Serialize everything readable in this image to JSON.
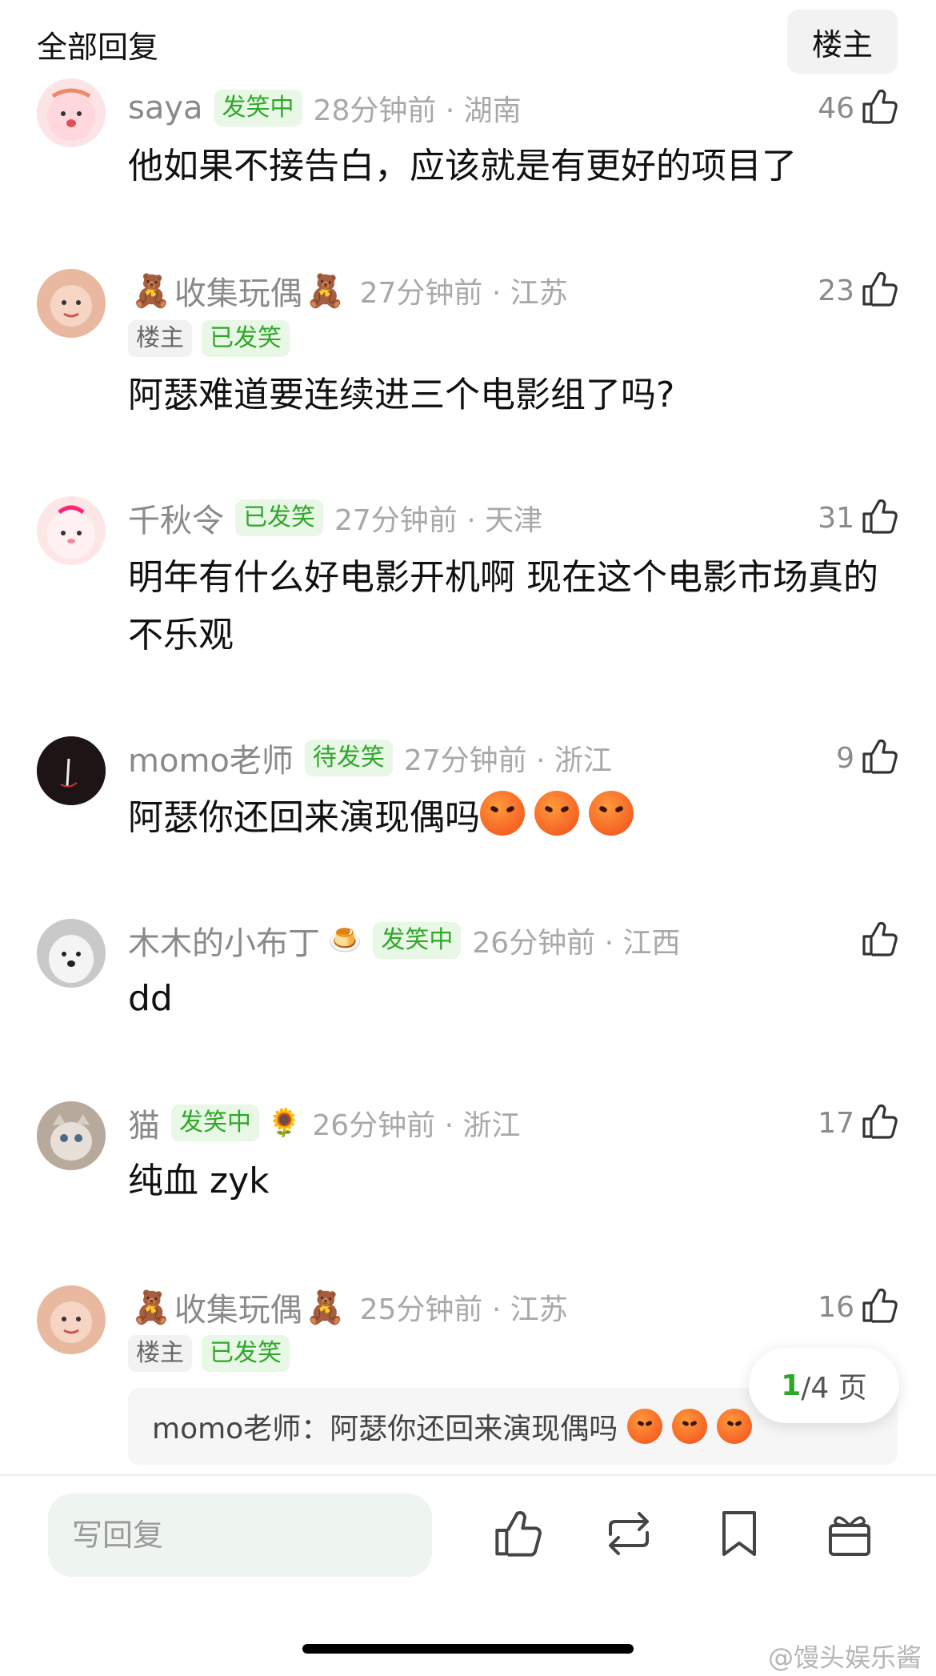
{
  "header": {
    "title": "全部回复",
    "owner_button": "楼主"
  },
  "comments": [
    {
      "user": "saya",
      "badge": "发笑中",
      "time": "28分钟前 · 湖南",
      "likes": "46",
      "text": "他如果不接告白，应该就是有更好的项目了"
    },
    {
      "user": "收集玩偶",
      "badge_owner": "楼主",
      "badge": "已发笑",
      "time": "27分钟前 · 江苏",
      "likes": "23",
      "text": "阿瑟难道要连续进三个电影组了吗?"
    },
    {
      "user": "千秋令",
      "badge": "已发笑",
      "time": "27分钟前 · 天津",
      "likes": "31",
      "text": "明年有什么好电影开机啊  现在这个电影市场真的不乐观"
    },
    {
      "user": "momo老师",
      "badge": "待发笑",
      "time": "27分钟前 · 浙江",
      "likes": "9",
      "text": "阿瑟你还回来演现偶吗"
    },
    {
      "user": "木木的小布丁",
      "badge": "发笑中",
      "time": "26分钟前 · 江西",
      "likes": "",
      "text": "dd"
    },
    {
      "user": "猫",
      "badge": "发笑中",
      "time": "26分钟前 · 浙江",
      "likes": "17",
      "text": "纯血 zyk"
    },
    {
      "user": "收集玩偶",
      "badge_owner": "楼主",
      "badge": "已发笑",
      "time": "25分钟前 · 江苏",
      "likes": "16",
      "quote": "momo老师：阿瑟你还回来演现偶吗"
    }
  ],
  "pager": {
    "current": "1",
    "total": "/4 页"
  },
  "bottom": {
    "reply_placeholder": "写回复"
  },
  "watermark": "@馒头娱乐酱",
  "colors": {
    "accent_green": "#2fa82a",
    "badge_bg": "#e9f7e6"
  }
}
